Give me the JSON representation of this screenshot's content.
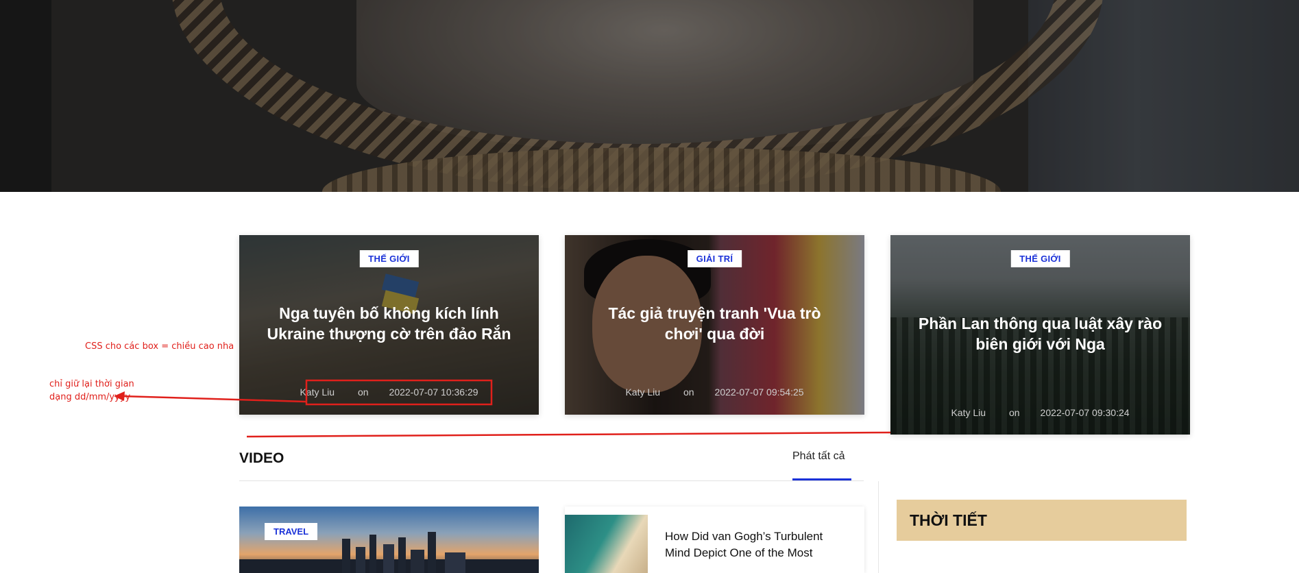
{
  "annotations": {
    "box_height_note": "CSS cho các box = chiều cao nha",
    "time_format_note_line1": "chỉ giữ lại thời gian",
    "time_format_note_line2": "dạng dd/mm/yyyy"
  },
  "featured": [
    {
      "category": "THẾ GIỚI",
      "title": "Nga tuyên bố không kích lính Ukraine thượng cờ trên đảo Rắn",
      "author": "Katy Liu",
      "on": "on",
      "datetime": "2022-07-07 10:36:29"
    },
    {
      "category": "GIẢI TRÍ",
      "title": "Tác giả truyện tranh 'Vua trò chơi' qua đời",
      "author": "Katy Liu",
      "on": "on",
      "datetime": "2022-07-07 09:54:25"
    },
    {
      "category": "THẾ GIỚI",
      "title": "Phần Lan thông qua luật xây rào biên giới với Nga",
      "author": "Katy Liu",
      "on": "on",
      "datetime": "2022-07-07 09:30:24"
    }
  ],
  "video_section": {
    "title": "VIDEO",
    "see_all": "Phát tất cả",
    "main_tag": "TRAVEL",
    "list": [
      {
        "title": "How Did van Gogh’s Turbulent Mind Depict One of the Most"
      }
    ]
  },
  "weather": {
    "title": "THỜI TIẾT"
  },
  "colors": {
    "accent_blue": "#1a31d8",
    "annotation_red": "#e0201b",
    "weather_bg": "#e6cc9c"
  }
}
